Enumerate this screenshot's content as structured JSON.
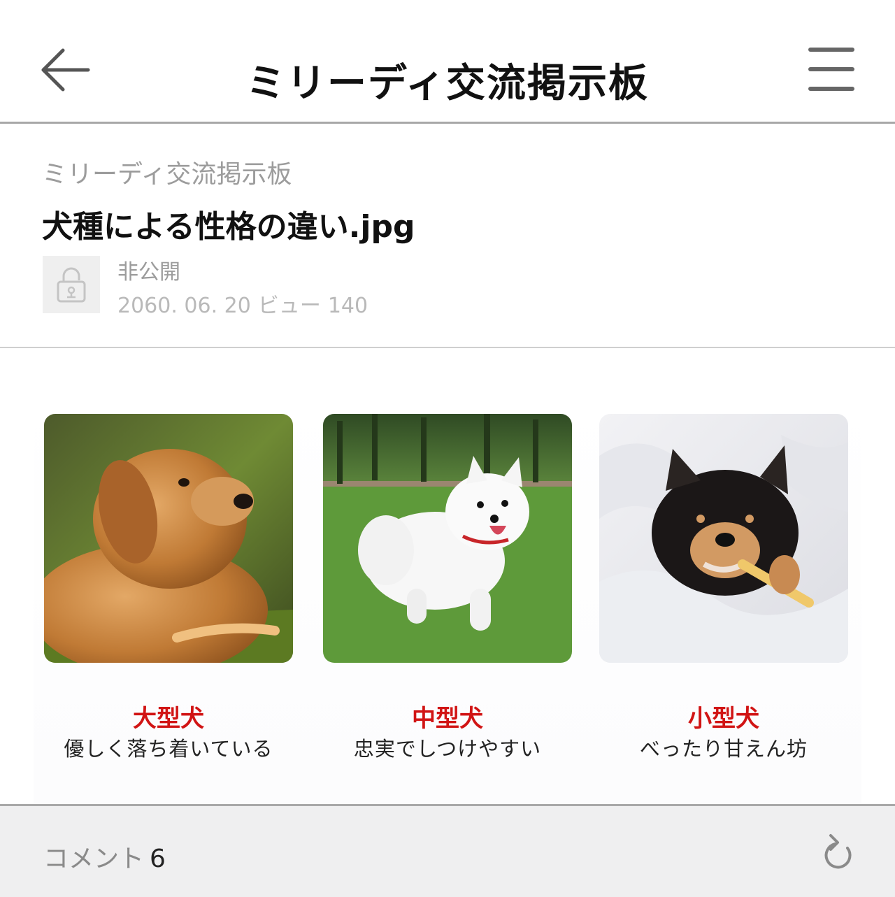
{
  "header": {
    "title": "ミリーディ交流掲示板",
    "back_icon": "arrow-left-icon",
    "menu_icon": "hamburger-menu-icon"
  },
  "post": {
    "board_name": "ミリーディ交流掲示板",
    "title": "犬種による性格の違い.jpg",
    "visibility": "非公開",
    "date": "2060. 06. 20",
    "views_label": "ビュー",
    "views": "140",
    "lock_icon": "padlock-icon"
  },
  "dogs": [
    {
      "type": "大型犬",
      "description": "優しく落ち着いている",
      "photo": "golden-retriever-puppy"
    },
    {
      "type": "中型犬",
      "description": "忠実でしつけやすい",
      "photo": "white-spitz-running"
    },
    {
      "type": "小型犬",
      "description": "べったり甘えん坊",
      "photo": "chihuahua-in-blanket"
    }
  ],
  "comments": {
    "label": "コメント",
    "count": "6",
    "refresh_icon": "refresh-icon"
  },
  "colors": {
    "accent_red": "#d11414",
    "divider": "#a8a8a8",
    "footer_bg": "#efeff0"
  }
}
